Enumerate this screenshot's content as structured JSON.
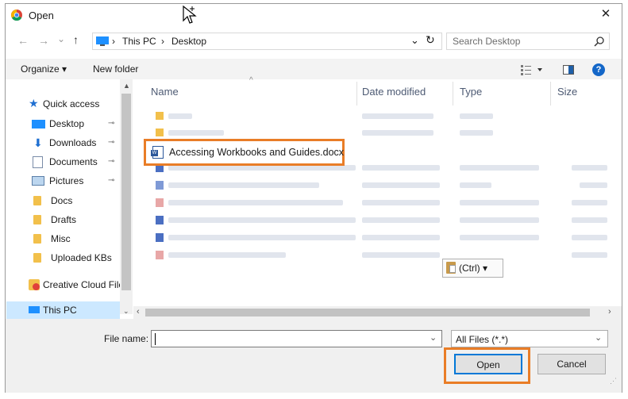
{
  "dialog": {
    "title": "Open",
    "close_glyph": "✕"
  },
  "nav": {
    "back": "←",
    "forward": "→",
    "recent": "⌄",
    "up": "↑",
    "breadcrumb": [
      "This PC",
      "Desktop"
    ],
    "separator": "›",
    "dropdown": "⌄",
    "refresh": "↻",
    "search_placeholder": "Search Desktop"
  },
  "toolbar": {
    "organize": "Organize ▾",
    "new_folder": "New folder",
    "help": "?"
  },
  "sidebar": {
    "items": [
      {
        "label": "Quick access",
        "icon": "star-icon",
        "pinned": false
      },
      {
        "label": "Desktop",
        "icon": "desktop-icon",
        "pinned": true
      },
      {
        "label": "Downloads",
        "icon": "download-icon",
        "pinned": true
      },
      {
        "label": "Documents",
        "icon": "document-icon",
        "pinned": true
      },
      {
        "label": "Pictures",
        "icon": "pictures-icon",
        "pinned": true
      },
      {
        "label": "Docs",
        "icon": "folder-icon",
        "pinned": false
      },
      {
        "label": "Drafts",
        "icon": "folder-icon",
        "pinned": false
      },
      {
        "label": "Misc",
        "icon": "folder-icon",
        "pinned": false
      },
      {
        "label": "Uploaded KBs",
        "icon": "folder-icon",
        "pinned": false
      },
      {
        "label": "Creative Cloud Files",
        "icon": "creative-cloud-icon",
        "pinned": false
      },
      {
        "label": "This PC",
        "icon": "pc-icon",
        "pinned": false
      }
    ],
    "pin_glyph": "📌"
  },
  "columns": {
    "name": "Name",
    "date": "Date modified",
    "type": "Type",
    "size": "Size"
  },
  "highlighted_file": "Accessing Workbooks and Guides.docx",
  "paste_options": "(Ctrl) ▾",
  "bottom": {
    "file_name_label": "File name:",
    "file_name_value": "",
    "filter": "All Files (*.*)",
    "open": "Open",
    "cancel": "Cancel"
  },
  "colors": {
    "accent": "#e97d27",
    "folder": "#f2c04b",
    "selected": "#cce8ff"
  }
}
